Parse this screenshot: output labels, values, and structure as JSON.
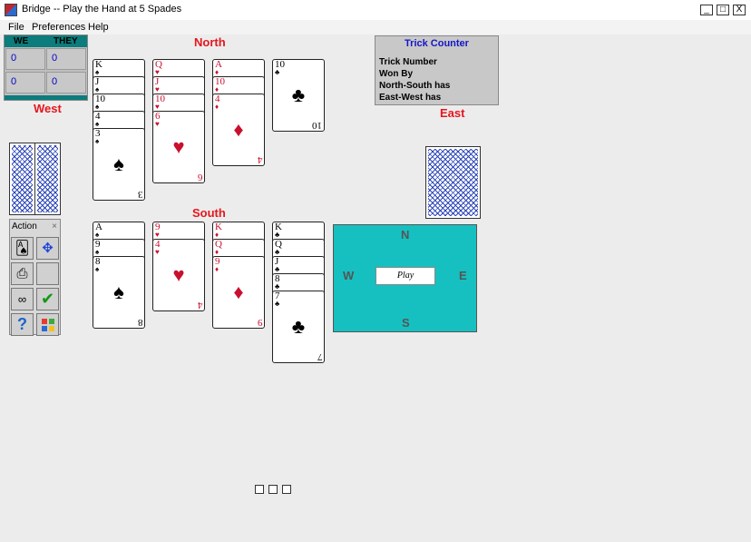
{
  "window": {
    "title": "Bridge -- Play the Hand at  5 Spades",
    "minimize": "_",
    "maximize": "□",
    "close": "X"
  },
  "menu": [
    "File",
    "Preferences",
    "Help"
  ],
  "scoreboard": {
    "headers": [
      "WE",
      "THEY"
    ],
    "rows": [
      [
        "0",
        "0"
      ],
      [
        "0",
        "0"
      ]
    ]
  },
  "seats": {
    "north": "North",
    "south": "South",
    "east": "East",
    "west": "West"
  },
  "trick_counter": {
    "title": "Trick Counter",
    "lines": [
      "Trick Number",
      "Won By",
      "North-South has",
      "East-West has"
    ]
  },
  "north_hand": [
    {
      "suit": "spades",
      "cards": [
        "K",
        "J",
        "10",
        "4",
        "3"
      ]
    },
    {
      "suit": "hearts",
      "cards": [
        "Q",
        "J",
        "10",
        "6"
      ]
    },
    {
      "suit": "diamonds",
      "cards": [
        "A",
        "10",
        "4"
      ]
    },
    {
      "suit": "clubs",
      "cards": [
        "10"
      ]
    }
  ],
  "south_hand": [
    {
      "suit": "spades",
      "cards": [
        "A",
        "9",
        "8"
      ]
    },
    {
      "suit": "hearts",
      "cards": [
        "9",
        "4"
      ]
    },
    {
      "suit": "diamonds",
      "cards": [
        "K",
        "Q",
        "9"
      ]
    },
    {
      "suit": "clubs",
      "cards": [
        "K",
        "Q",
        "J",
        "8",
        "7"
      ]
    }
  ],
  "action_panel": {
    "title": "Action",
    "close": "×",
    "buttons": [
      "deal-icon",
      "move-arrows-icon",
      "printer-icon",
      "blank-icon",
      "glasses-icon",
      "confirm-check-icon",
      "help-question-icon",
      "windows-logo-icon"
    ],
    "confirm_label": "Confirm"
  },
  "compass": {
    "n": "N",
    "s": "S",
    "e": "E",
    "w": "W",
    "play_label": "Play"
  },
  "colors": {
    "compass_bg": "#16c0c0",
    "seat_label": "#e5161d",
    "trick_title": "#1515c8",
    "score_header": "#0c7c7c"
  }
}
